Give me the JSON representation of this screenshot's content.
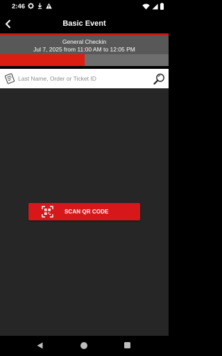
{
  "status_bar": {
    "time": "2:46",
    "left_icons": [
      "gear-icon",
      "download-icon",
      "warning-icon"
    ],
    "right_icons": [
      "wifi-icon",
      "signal-icon",
      "battery-icon"
    ]
  },
  "app_bar": {
    "title": "Basic Event",
    "back_icon": "chevron-left-icon"
  },
  "session": {
    "name": "General Checkin",
    "schedule": "Jul  7, 2025 from 11:00 AM to 12:05 PM"
  },
  "progress": {
    "fraction": 0.5
  },
  "search": {
    "placeholder": "Last Name, Order or Ticket ID",
    "value": ""
  },
  "scan": {
    "label": "SCAN QR CODE"
  },
  "colors": {
    "accent": "#d7181b",
    "main_background": "#262626",
    "session_background": "#585858"
  }
}
